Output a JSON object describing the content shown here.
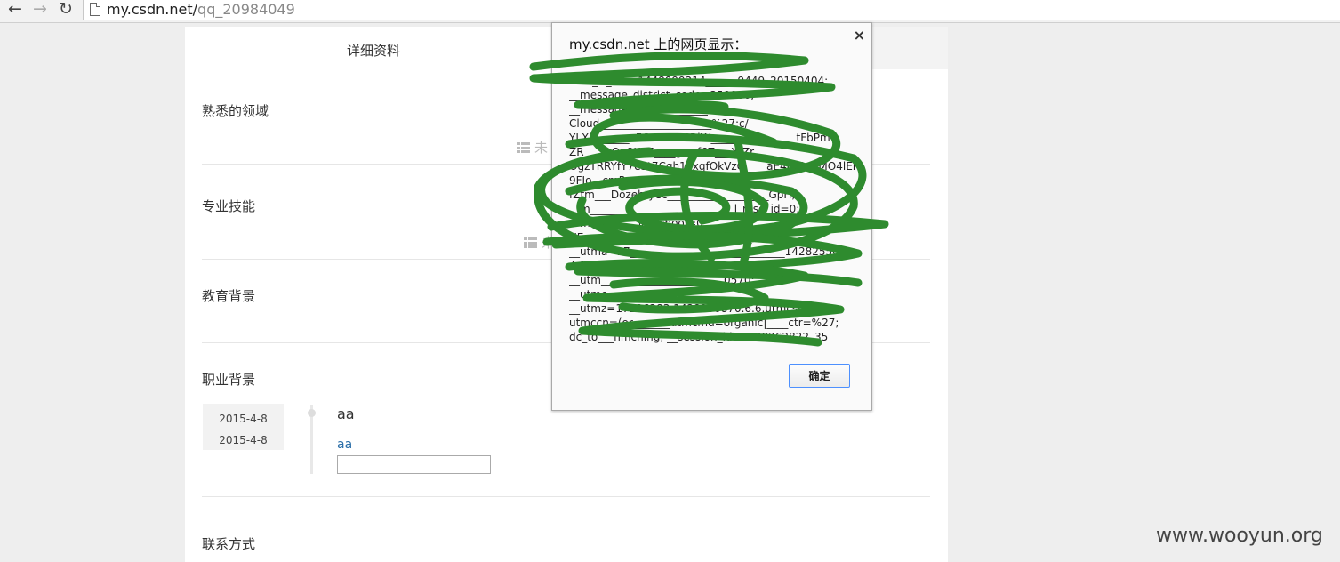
{
  "browser": {
    "url_host": "my.csdn.net/",
    "url_path": "qq_20984049"
  },
  "tabs": {
    "active_label": "详细资料"
  },
  "sections": [
    {
      "title": "熟悉的领域",
      "empty_text": "未"
    },
    {
      "title": "专业技能",
      "empty_text": "未"
    },
    {
      "title": "教育背景"
    },
    {
      "title": "职业背景"
    },
    {
      "title": "联系方式"
    }
  ],
  "career": {
    "date_start": "2015-4-8",
    "date_sep": "-",
    "date_end": "2015-4-8",
    "title": "aa",
    "link_text": "aa",
    "input_value": ""
  },
  "dialog": {
    "title": "my.csdn.net 上的网页显示：",
    "close_label": "×",
    "message_lines": [
      "uuid_tt_dd=-1448099214______9449_20150404;",
      "__message_district_code=350000;",
      "__message_______________4;",
      "Cloud_____________________%27;c/",
      "YLXl_______aFGzI2vRICRlW________________tFbPm",
      "ZR____yOp8K6E____gwxf6Z___X[Zr",
      "OgzTRRYfY7eSt7Cgh1vxqfOkVzO____aE4UjQucMO4lEI",
      "9FIo__cmP___UA/YIIWv/",
      "fZtm___Dozehtyec___________________GpH;",
      "__m___________________________l_msg_id=0;",
      "__m_________in_school=0;",
      "UE=_______________om|___utm____;",
      "__utma=17_____________________________14282550",
      "4.14___25___;",
      "__utm_______________________0570;",
      "__utmc=______;",
      "__utmz=17226283.1428250870.6.6.utmcsr=sol",
      "utmccn=(or_______utmcmd=organic|____ctr=%27;",
      "dc_to___hmching; __session_id=1428262822_35"
    ],
    "ok_label": "确定",
    "scribble_color": "#2e8b2e"
  },
  "watermark": "www.wooyun.org"
}
